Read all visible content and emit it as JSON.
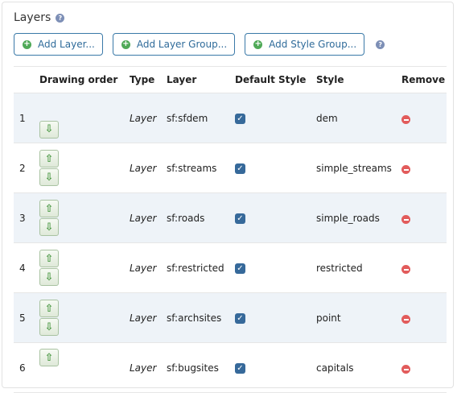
{
  "header": {
    "title": "Layers",
    "help_icon": "?"
  },
  "toolbar": {
    "add_layer": "Add Layer...",
    "add_layer_group": "Add Layer Group...",
    "add_style_group": "Add Style Group...",
    "plus_icon": "+",
    "help_icon": "?"
  },
  "table": {
    "columns": [
      "Drawing order",
      "Type",
      "Layer",
      "Default Style",
      "Style",
      "Remove"
    ],
    "icons": {
      "up": "⇧",
      "down": "⇩",
      "check": "✓"
    },
    "rows": [
      {
        "order": "1",
        "type": "Layer",
        "layer": "sf:sfdem",
        "default_style": true,
        "style": "dem"
      },
      {
        "order": "2",
        "type": "Layer",
        "layer": "sf:streams",
        "default_style": true,
        "style": "simple_streams"
      },
      {
        "order": "3",
        "type": "Layer",
        "layer": "sf:roads",
        "default_style": true,
        "style": "simple_roads"
      },
      {
        "order": "4",
        "type": "Layer",
        "layer": "sf:restricted",
        "default_style": true,
        "style": "restricted"
      },
      {
        "order": "5",
        "type": "Layer",
        "layer": "sf:archsites",
        "default_style": true,
        "style": "point"
      },
      {
        "order": "6",
        "type": "Layer",
        "layer": "sf:bugsites",
        "default_style": true,
        "style": "capitals"
      }
    ]
  },
  "colors": {
    "accent": "#2f6b9a",
    "add_green": "#4fa957",
    "remove_red": "#e25b5b",
    "row_stripe": "#eef3f8"
  }
}
